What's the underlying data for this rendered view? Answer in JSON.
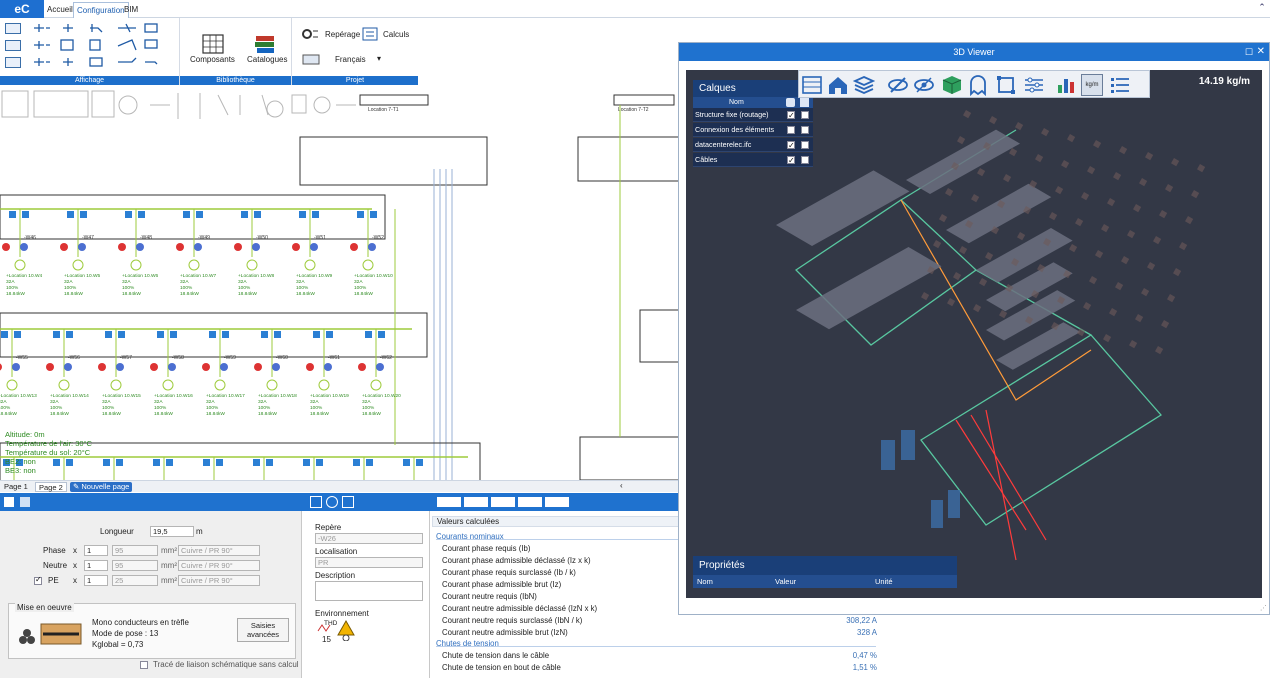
{
  "app": {
    "logo": "eC",
    "tabs": [
      "Accueil",
      "Configuration",
      "BIM"
    ],
    "active_tab": "Configuration"
  },
  "ribbon": {
    "groups": [
      {
        "label": "Affichage"
      },
      {
        "label": "Bibliothèque",
        "items": [
          "Composants",
          "Catalogues"
        ]
      },
      {
        "label": "Projet",
        "items": [
          "Repérage",
          "Calculs",
          "Français"
        ]
      }
    ]
  },
  "schematic": {
    "panel_labels": {
      "altitude": "Altitude: 0m",
      "air_temp": "Température de l'air: 30°C",
      "soil_temp": "Température du sol: 20°C",
      "be2": "BE2: non",
      "be3": "BE3: non"
    },
    "row1_loads": [
      "Location 10.W4",
      "Location 10.W5",
      "Location 10.W6",
      "Location 10.W7",
      "Location 10.W8",
      "Location 10.W9",
      "Location 10.W10"
    ],
    "row2_loads": [
      "Location 10.W13",
      "Location 10.W14",
      "Location 10.W15",
      "Location 10.W16",
      "Location 10.W17",
      "Location 10.W18",
      "Location 10.W19",
      "Location 10.W20"
    ],
    "load_spec": {
      "current": "32A",
      "pct": "100%",
      "power": "18.84kW"
    },
    "feeders_row1": [
      "W46",
      "W47",
      "W48",
      "W49",
      "W50",
      "W51",
      "W52"
    ],
    "feeders_row2": [
      "W55",
      "W56",
      "W57",
      "W58",
      "W59",
      "W60",
      "W61",
      "W62"
    ]
  },
  "page_tabs": [
    "Page 1",
    "Page 2",
    "Nouvelle page"
  ],
  "properties": {
    "longueur_label": "Longueur",
    "longueur_value": "19,5",
    "longueur_unit": "m",
    "rows": [
      {
        "label": "Phase",
        "count": "1",
        "section": "95",
        "unit": "mm²",
        "material": "Cuivre / PR 90°"
      },
      {
        "label": "Neutre",
        "count": "1",
        "section": "95",
        "unit": "mm²",
        "material": "Cuivre / PR 90°"
      },
      {
        "label": "PE",
        "count": "1",
        "section": "25",
        "unit": "mm²",
        "material": "Cuivre / PR 90°"
      }
    ],
    "x": "x",
    "mise_en_oeuvre_title": "Mise en oeuvre",
    "mise_lines": [
      "Mono conducteurs en trèfle",
      "Mode de pose : 13",
      "Kglobal = 0,73"
    ],
    "saisies_button": "Saisies avancées",
    "trace_checkbox": "Tracé de liaison schématique sans calcul"
  },
  "identity": {
    "repere_label": "Repère",
    "repere_value": "-W26",
    "localisation_label": "Localisation",
    "localisation_value": "PR",
    "description_label": "Description",
    "environnement_label": "Environnement",
    "thd_label": "THD",
    "thd_value": "15"
  },
  "calculated": {
    "title": "Valeurs calculées",
    "sections": [
      {
        "name": "Courants nominaux",
        "rows": [
          {
            "label": "Courant phase requis (Ib)",
            "value": ""
          },
          {
            "label": "Courant phase admissible déclassé (Iz x k)",
            "value": ""
          },
          {
            "label": "Courant phase requis surclassé (Ib / k)",
            "value": ""
          },
          {
            "label": "Courant phase admissible brut (Iz)",
            "value": ""
          },
          {
            "label": "Courant neutre requis (IbN)",
            "value": ""
          },
          {
            "label": "Courant neutre admissible déclassé (IzN x k)",
            "value": ""
          },
          {
            "label": "Courant neutre requis surclassé (IbN / k)",
            "value": "308,22 A"
          },
          {
            "label": "Courant neutre admissible brut (IzN)",
            "value": "328 A"
          }
        ]
      },
      {
        "name": "Chutes de tension",
        "rows": [
          {
            "label": "Chute de tension dans le câble",
            "value": "0,47 %"
          },
          {
            "label": "Chute de tension en bout de câble",
            "value": "1,51 %"
          }
        ]
      }
    ]
  },
  "viewer": {
    "title": "3D Viewer",
    "scale": "14.19 kg/m",
    "kgm_button": "kg/m",
    "layers": {
      "title": "Calques",
      "column_name": "Nom",
      "items": [
        {
          "name": "Structure fixe (routage)",
          "visible": true,
          "locked": false
        },
        {
          "name": "Connexion des éléments",
          "visible": false,
          "locked": false
        },
        {
          "name": "datacenterelec.ifc",
          "visible": true,
          "locked": false
        },
        {
          "name": "Câbles",
          "visible": true,
          "locked": false
        }
      ]
    },
    "properties": {
      "title": "Propriétés",
      "columns": [
        "Nom",
        "Valeur",
        "Unité"
      ]
    }
  }
}
